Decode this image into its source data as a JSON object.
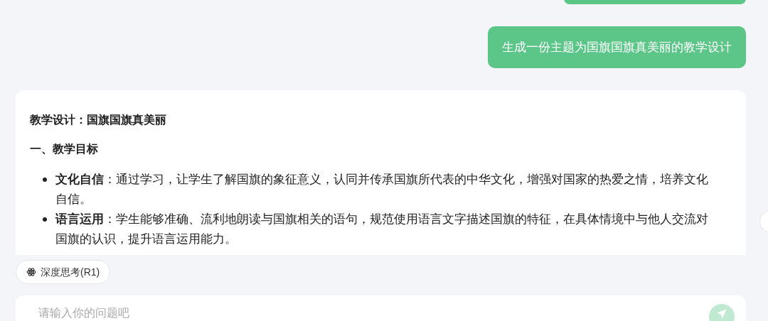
{
  "user_messages": [
    "生成一份主题为国旗国旗真美丽的教学设计"
  ],
  "answer": {
    "title": "教学设计：国旗国旗真美丽",
    "section": "一、教学目标",
    "bullets": [
      {
        "term": "文化自信",
        "text": "：通过学习，让学生了解国旗的象征意义，认同并传承国旗所代表的中华文化，增强对国家的热爱之情，培养文化自信。"
      },
      {
        "term": "语言运用",
        "text": "：学生能够准确、流利地朗读与国旗相关的语句，规范使用语言文字描述国旗的特征，在具体情境中与他人交流对国旗的认识，提升语言运用能力。"
      }
    ]
  },
  "deep_think": {
    "label": "深度思考(R1)",
    "selected": false
  },
  "input": {
    "placeholder": "请输入你的问题吧"
  }
}
